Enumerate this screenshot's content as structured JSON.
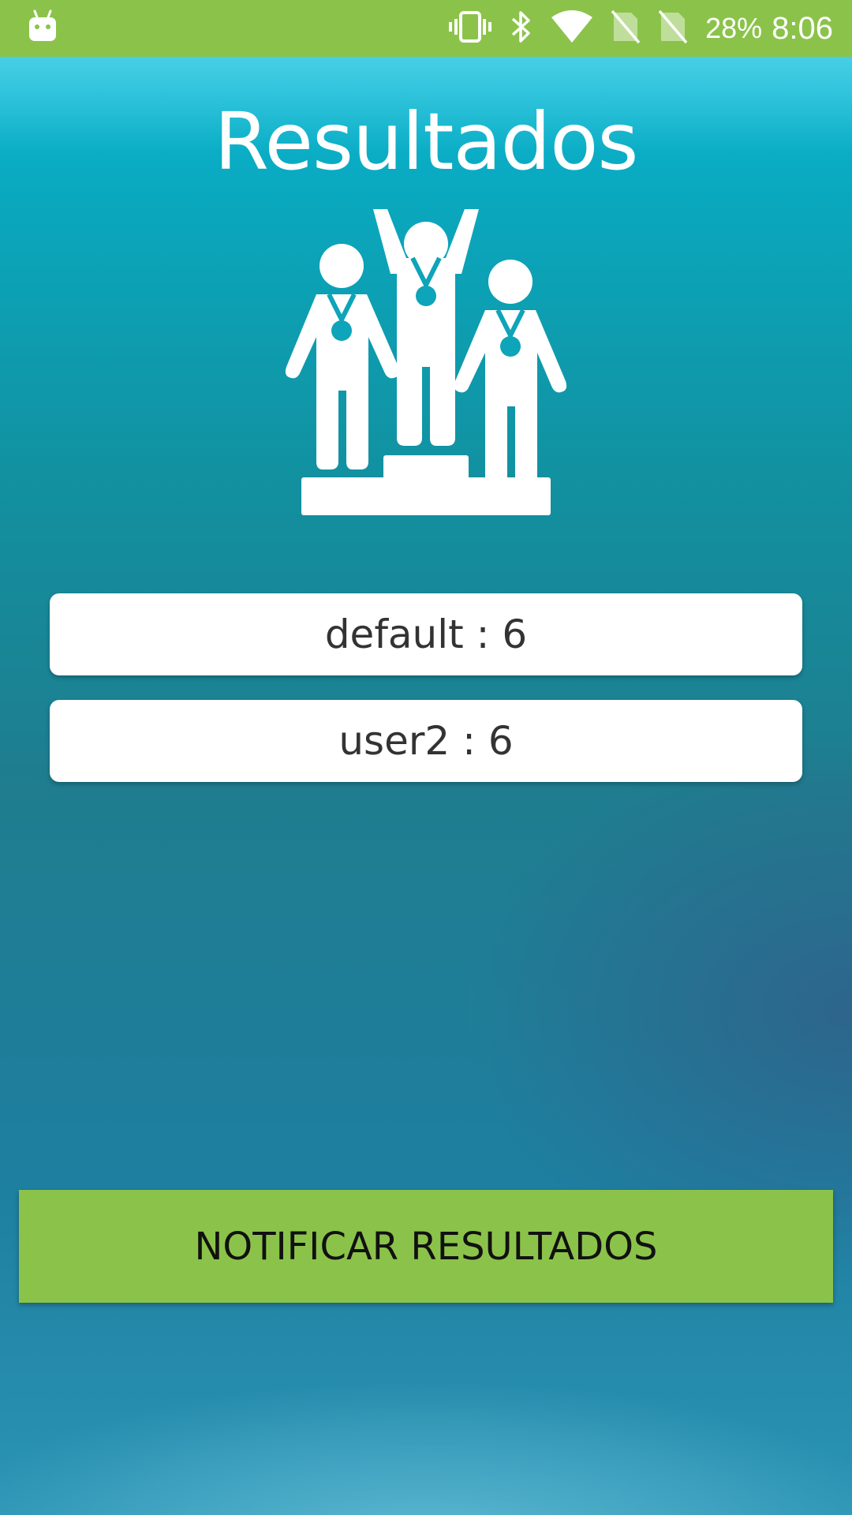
{
  "status_bar": {
    "battery_percent": "28%",
    "time": "8:06",
    "icons": [
      "android-notification-icon",
      "vibrate-icon",
      "bluetooth-icon",
      "wifi-icon",
      "no-sim-icon",
      "no-sim-icon"
    ]
  },
  "page": {
    "title": "Resultados"
  },
  "illustration": {
    "icon": "podium-winners-icon"
  },
  "results": [
    {
      "text": "default : 6"
    },
    {
      "text": "user2 : 6"
    }
  ],
  "actions": {
    "notify_label": "NOTIFICAR RESULTADOS"
  },
  "colors": {
    "status_bar": "#8bc34a",
    "button": "#8bc34a",
    "background_top": "#0cc0dd",
    "background_bottom": "#2b94b5",
    "card": "#ffffff"
  }
}
